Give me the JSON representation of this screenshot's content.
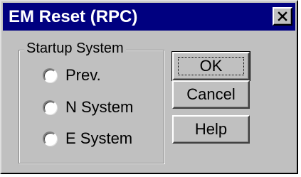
{
  "window": {
    "title": "EM Reset (RPC)",
    "close_icon": "close-icon",
    "title_bar_color": "#000080",
    "face_color": "#c0c0c0"
  },
  "startup_group": {
    "legend": "Startup System",
    "options": [
      {
        "label": "Prev.",
        "icon": "radio-unchecked-icon",
        "selected": false
      },
      {
        "label": "N System",
        "icon": "radio-unchecked-icon",
        "selected": false
      },
      {
        "label": "E System",
        "icon": "radio-unchecked-icon",
        "selected": false
      }
    ]
  },
  "buttons": {
    "ok": "OK",
    "cancel": "Cancel",
    "help": "Help"
  }
}
